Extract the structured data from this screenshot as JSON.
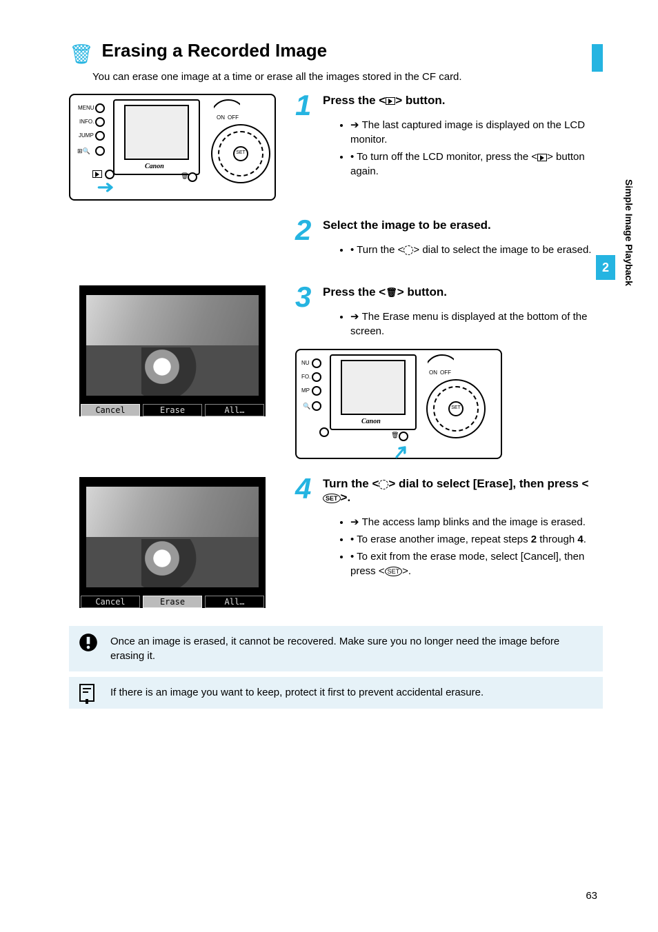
{
  "header": {
    "title": "Erasing a Recorded Image",
    "intro": "You can erase one image at a time or erase all the images stored in the CF card."
  },
  "side_label": "Simple Image Playback",
  "page_tab": "2",
  "page_number": "63",
  "steps": [
    {
      "title": "Press the < ▶ > button.",
      "lines": [
        "The last captured image is displayed on the LCD monitor.",
        "To turn off the LCD monitor, press the < ▶ > button again."
      ]
    },
    {
      "title": "Select the image to be erased.",
      "lines": [
        "Turn the < ◯ > dial to select the image to be erased."
      ]
    },
    {
      "title": "Press the < 🗑 > button.",
      "lines": [
        "The Erase menu is displayed at the bottom of the screen."
      ]
    },
    {
      "title": "Turn the < ◯ > dial to select [Erase], then press < SET >.",
      "lines": [
        "The access lamp blinks and the image is erased.",
        "To erase another image, repeat steps 2 through 4.",
        "To exit from the erase mode, select [Cancel], then press < SET >."
      ]
    }
  ],
  "osd": {
    "cancel": "Cancel",
    "erase": "Erase",
    "all": "All…"
  },
  "camera_labels": {
    "menu": "MENU",
    "info": "INFO.",
    "jump": "JUMP",
    "on": "ON",
    "off": "OFF",
    "set": "SET",
    "canon": "Canon"
  },
  "notes": {
    "warn": "Once an image is erased, it cannot be recovered. Make sure you no longer need the image before erasing it.",
    "info": "If there is an image you want to keep, protect it first to prevent accidental erasure."
  }
}
